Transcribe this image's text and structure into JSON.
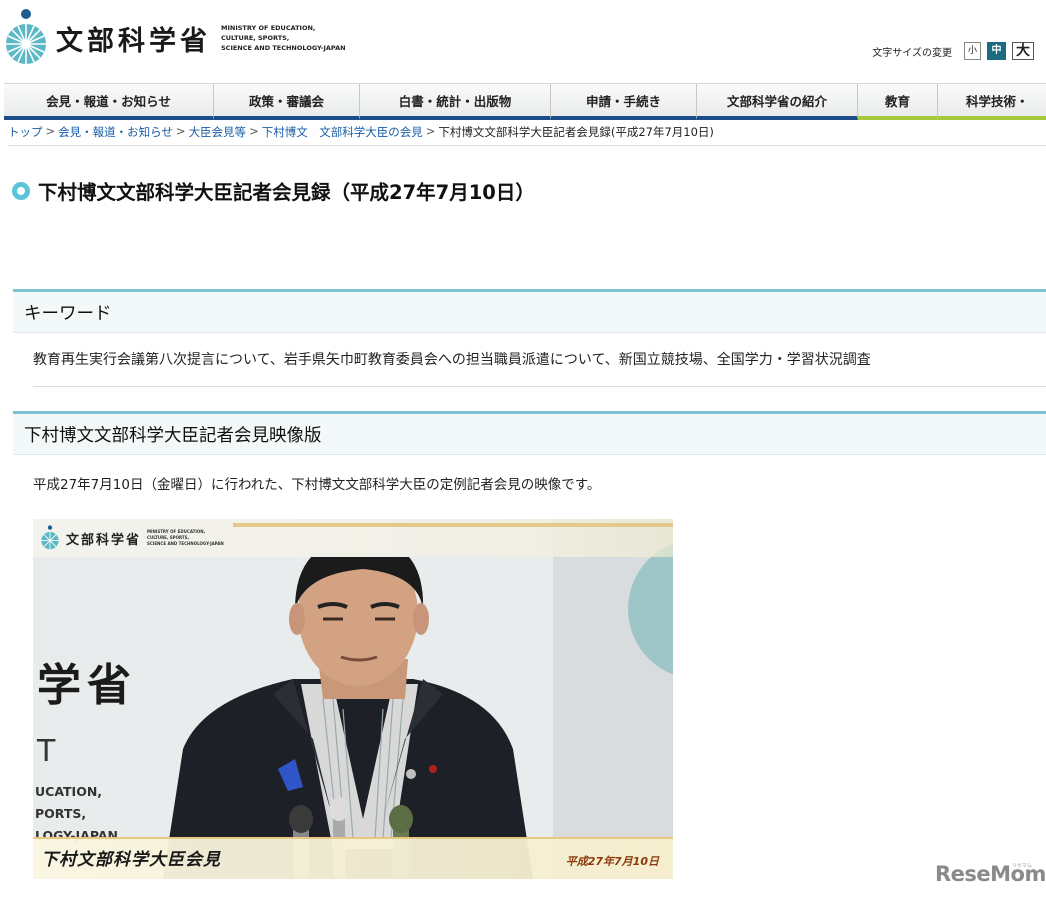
{
  "header": {
    "logo_text": "文部科学省",
    "logo_en_lines": [
      "MINISTRY OF EDUCATION,",
      "CULTURE, SPORTS,",
      "SCIENCE AND TECHNOLOGY-JAPAN"
    ],
    "font_size_label": "文字サイズの変更",
    "font_size_options": [
      "小",
      "中",
      "大"
    ],
    "font_size_selected": "中"
  },
  "nav": {
    "items": [
      {
        "label": "会見・報道・お知らせ"
      },
      {
        "label": "政策・審議会"
      },
      {
        "label": "白書・統計・出版物"
      },
      {
        "label": "申請・手続き"
      },
      {
        "label": "文部科学省の紹介"
      },
      {
        "label": "教育"
      },
      {
        "label": "科学技術・"
      }
    ]
  },
  "breadcrumb": {
    "items": [
      "トップ",
      "会見・報道・お知らせ",
      "大臣会見等",
      "下村博文　文部科学大臣の会見"
    ],
    "current": "下村博文文部科学大臣記者会見録(平成27年7月10日)",
    "separator": ">"
  },
  "page_title": "下村博文文部科学大臣記者会見録（平成27年7月10日）",
  "keywords": {
    "heading": "キーワード",
    "text": "教育再生実行会議第八次提言について、岩手県矢巾町教育委員会への担当職員派遣について、新国立競技場、全国学力・学習状況調査"
  },
  "video_section": {
    "heading": "下村博文文部科学大臣記者会見映像版",
    "description": "平成27年7月10日（金曜日）に行われた、下村博文文部科学大臣の定例記者会見の映像です。",
    "video": {
      "logo_text": "文部科学省",
      "logo_en_lines": [
        "MINISTRY OF EDUCATION,",
        "CULTURE, SPORTS,",
        "SCIENCE AND TECHNOLOGY-JAPAN"
      ],
      "wall_text": "学省",
      "wall_letter": "T",
      "wall_lines": [
        "UCATION,",
        "PORTS,",
        "LOGY-JAPAN"
      ],
      "caption": "下村文部科学大臣会見",
      "caption_date": "平成27年7月10日"
    }
  },
  "watermark": {
    "text": "ReseMom",
    "small": "リセマム"
  },
  "colors": {
    "nav_underline": "#1e4d8c",
    "nav_underline_green": "#a5c83c",
    "section_border": "#7cc4d2",
    "title_bullet": "#5bc3da",
    "link": "#1a5ea8"
  }
}
